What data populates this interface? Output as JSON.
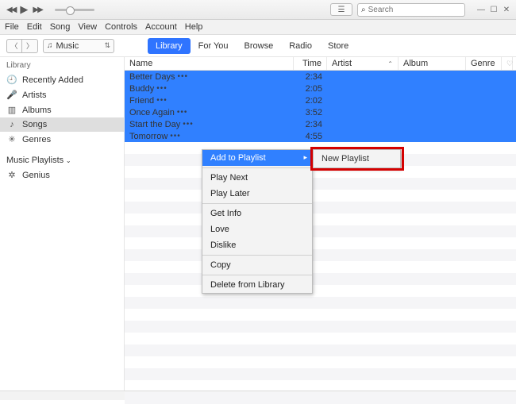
{
  "window": {
    "search_placeholder": "Search"
  },
  "menubar": [
    "File",
    "Edit",
    "Song",
    "View",
    "Controls",
    "Account",
    "Help"
  ],
  "media_selector": {
    "label": "Music"
  },
  "tabs": [
    {
      "label": "Library",
      "active": true
    },
    {
      "label": "For You"
    },
    {
      "label": "Browse"
    },
    {
      "label": "Radio"
    },
    {
      "label": "Store"
    }
  ],
  "sidebar": {
    "library_header": "Library",
    "library_items": [
      {
        "icon": "🕘",
        "label": "Recently Added"
      },
      {
        "icon": "🎤",
        "label": "Artists"
      },
      {
        "icon": "▥",
        "label": "Albums"
      },
      {
        "icon": "♪",
        "label": "Songs",
        "active": true
      },
      {
        "icon": "✳",
        "label": "Genres"
      }
    ],
    "playlists_header": "Music Playlists",
    "playlists": [
      {
        "icon": "✲",
        "label": "Genius"
      }
    ]
  },
  "columns": {
    "name": "Name",
    "time": "Time",
    "artist": "Artist",
    "album": "Album",
    "genre": "Genre"
  },
  "tracks": [
    {
      "name": "Better Days",
      "time": "2:34"
    },
    {
      "name": "Buddy",
      "time": "2:05"
    },
    {
      "name": "Friend",
      "time": "2:02"
    },
    {
      "name": "Once Again",
      "time": "3:52"
    },
    {
      "name": "Start the Day",
      "time": "2:34"
    },
    {
      "name": "Tomorrow",
      "time": "4:55"
    }
  ],
  "context_menu": {
    "items": [
      {
        "label": "Add to Playlist",
        "highlight": true,
        "submenu": true
      },
      {
        "sep": true
      },
      {
        "label": "Play Next"
      },
      {
        "label": "Play Later"
      },
      {
        "sep": true
      },
      {
        "label": "Get Info"
      },
      {
        "label": "Love"
      },
      {
        "label": "Dislike"
      },
      {
        "sep": true
      },
      {
        "label": "Copy"
      },
      {
        "sep": true
      },
      {
        "label": "Delete from Library"
      }
    ],
    "submenu": {
      "label": "New Playlist"
    }
  }
}
